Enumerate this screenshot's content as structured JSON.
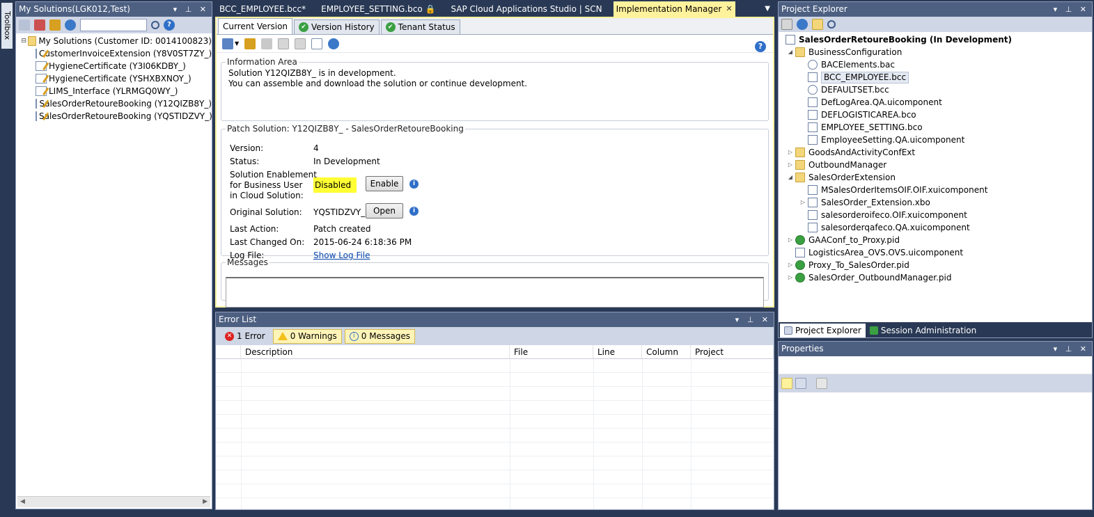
{
  "toolbox": {
    "label": "Toolbox"
  },
  "my_solutions": {
    "title": "My Solutions(LGK012,Test)",
    "controls": "▾ ⊥ ✕",
    "search_placeholder": "",
    "root": "My Solutions (Customer ID: 0014100823)",
    "items": [
      "CustomerInvoiceExtension (Y8V0ST7ZY_)",
      "HygieneCertificate (Y3I06KDBY_)",
      "HygieneCertificate (YSHXBXNOY_)",
      "LIMS_Interface (YLRMGQ0WY_)",
      "SalesOrderRetoureBooking (Y12QIZB8Y_)",
      "SalesOrderRetoureBooking (YQSTIDZVY_)"
    ]
  },
  "doc_tabs": [
    {
      "label": "BCC_EMPLOYEE.bcc*"
    },
    {
      "label": "EMPLOYEE_SETTING.bco 🔒"
    },
    {
      "label": "SAP Cloud Applications Studio | SCN"
    },
    {
      "label": "Implementation Manager"
    }
  ],
  "impl": {
    "tabs": [
      "Current Version",
      "Version History",
      "Tenant Status"
    ],
    "info_area": {
      "legend": "Information Area",
      "line1": "Solution Y12QIZB8Y_ is in development.",
      "line2": "You can assemble and download the solution or continue development."
    },
    "patch": {
      "legend": "Patch Solution: Y12QIZB8Y_ - SalesOrderRetoureBooking",
      "version_label": "Version:",
      "version_value": "4",
      "status_label": "Status:",
      "status_value": "In Development",
      "enablement_label_1": "Solution Enablement",
      "enablement_label_2": "for Business User",
      "enablement_label_3": "in Cloud Solution:",
      "enablement_value": "Disabled",
      "enable_button": "Enable",
      "original_label": "Original Solution:",
      "original_value": "YQSTIDZVY_",
      "open_button": "Open",
      "last_action_label": "Last Action:",
      "last_action_value": "Patch created",
      "last_changed_label": "Last Changed On:",
      "last_changed_value": "2015-06-24 6:18:36 PM",
      "log_label": "Log File:",
      "log_link": "Show Log File"
    },
    "messages_legend": "Messages"
  },
  "error_list": {
    "title": "Error List",
    "errors": "1 Error",
    "warnings": "0 Warnings",
    "messages": "0 Messages",
    "columns": [
      "Description",
      "File",
      "Line",
      "Column",
      "Project"
    ]
  },
  "project_explorer": {
    "title": "Project Explorer",
    "root": "SalesOrderRetoureBooking (In Development)",
    "items": [
      {
        "label": "BusinessConfiguration",
        "depth": 1,
        "toggle": "◢",
        "icon": "folder"
      },
      {
        "label": "BACElements.bac",
        "depth": 2,
        "toggle": "",
        "icon": "gear"
      },
      {
        "label": "BCC_EMPLOYEE.bcc",
        "depth": 2,
        "toggle": "",
        "icon": "file",
        "selected": true
      },
      {
        "label": "DEFAULTSET.bcc",
        "depth": 2,
        "toggle": "",
        "icon": "gear"
      },
      {
        "label": "DefLogArea.QA.uicomponent",
        "depth": 2,
        "toggle": "",
        "icon": "file"
      },
      {
        "label": "DEFLOGISTICAREA.bco",
        "depth": 2,
        "toggle": "",
        "icon": "file"
      },
      {
        "label": "EMPLOYEE_SETTING.bco",
        "depth": 2,
        "toggle": "",
        "icon": "file"
      },
      {
        "label": "EmployeeSetting.QA.uicomponent",
        "depth": 2,
        "toggle": "",
        "icon": "file"
      },
      {
        "label": "GoodsAndActivityConfExt",
        "depth": 1,
        "toggle": "▷",
        "icon": "folder"
      },
      {
        "label": "OutboundManager",
        "depth": 1,
        "toggle": "▷",
        "icon": "folder"
      },
      {
        "label": "SalesOrderExtension",
        "depth": 1,
        "toggle": "◢",
        "icon": "folder"
      },
      {
        "label": "MSalesOrderItemsOIF.OIF.xuicomponent",
        "depth": 2,
        "toggle": "",
        "icon": "file"
      },
      {
        "label": "SalesOrder_Extension.xbo",
        "depth": 2,
        "toggle": "▷",
        "icon": "file"
      },
      {
        "label": "salesorderoifeco.OIF.xuicomponent",
        "depth": 2,
        "toggle": "",
        "icon": "file"
      },
      {
        "label": "salesorderqafeco.QA.xuicomponent",
        "depth": 2,
        "toggle": "",
        "icon": "file"
      },
      {
        "label": "GAAConf_to_Proxy.pid",
        "depth": 1,
        "toggle": "▷",
        "icon": "pid"
      },
      {
        "label": "LogisticsArea_OVS.OVS.uicomponent",
        "depth": 1,
        "toggle": "",
        "icon": "file"
      },
      {
        "label": "Proxy_To_SalesOrder.pid",
        "depth": 1,
        "toggle": "▷",
        "icon": "pid"
      },
      {
        "label": "SalesOrder_OutboundManager.pid",
        "depth": 1,
        "toggle": "▷",
        "icon": "pid"
      }
    ],
    "tab_project": "Project Explorer",
    "tab_session": "Session Administration"
  },
  "properties": {
    "title": "Properties"
  }
}
